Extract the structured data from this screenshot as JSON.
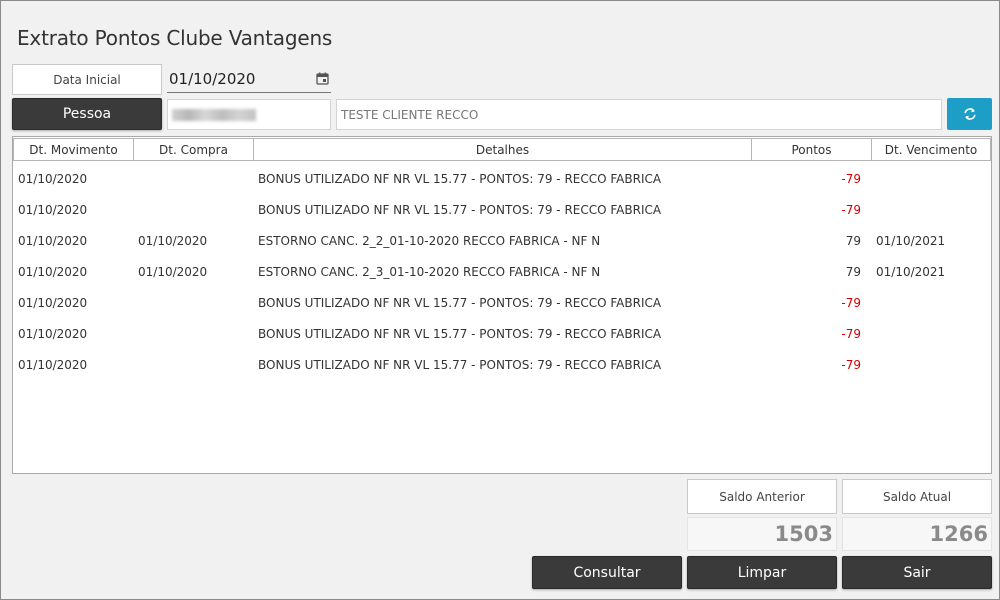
{
  "title": "Extrato Pontos Clube Vantagens",
  "filters": {
    "data_inicial_label": "Data Inicial",
    "data_inicial_value": "01/10/2020",
    "pessoa_button": "Pessoa",
    "pessoa_name": "TESTE CLIENTE RECCO"
  },
  "table": {
    "headers": [
      "Dt. Movimento",
      "Dt. Compra",
      "Detalhes",
      "Pontos",
      "Dt. Vencimento"
    ],
    "rows": [
      {
        "dt_movimento": "01/10/2020",
        "dt_compra": "",
        "detalhes": "BONUS UTILIZADO NF NR  VL 15.77 - PONTOS: 79 - RECCO FABRICA",
        "pontos": "-79",
        "dt_vencimento": ""
      },
      {
        "dt_movimento": "01/10/2020",
        "dt_compra": "",
        "detalhes": "BONUS UTILIZADO NF NR  VL 15.77 - PONTOS: 79 - RECCO FABRICA",
        "pontos": "-79",
        "dt_vencimento": ""
      },
      {
        "dt_movimento": "01/10/2020",
        "dt_compra": "01/10/2020",
        "detalhes": "ESTORNO CANC. 2_2_01-10-2020 RECCO FABRICA - NF N",
        "pontos": "79",
        "dt_vencimento": "01/10/2021"
      },
      {
        "dt_movimento": "01/10/2020",
        "dt_compra": "01/10/2020",
        "detalhes": "ESTORNO CANC. 2_3_01-10-2020 RECCO FABRICA - NF N",
        "pontos": "79",
        "dt_vencimento": "01/10/2021"
      },
      {
        "dt_movimento": "01/10/2020",
        "dt_compra": "",
        "detalhes": "BONUS UTILIZADO NF NR  VL 15.77 - PONTOS: 79 - RECCO FABRICA",
        "pontos": "-79",
        "dt_vencimento": ""
      },
      {
        "dt_movimento": "01/10/2020",
        "dt_compra": "",
        "detalhes": "BONUS UTILIZADO NF NR  VL 15.77 - PONTOS: 79 - RECCO FABRICA",
        "pontos": "-79",
        "dt_vencimento": ""
      },
      {
        "dt_movimento": "01/10/2020",
        "dt_compra": "",
        "detalhes": "BONUS UTILIZADO NF NR  VL 15.77 - PONTOS: 79 - RECCO FABRICA",
        "pontos": "-79",
        "dt_vencimento": ""
      }
    ]
  },
  "summary": {
    "saldo_anterior_label": "Saldo Anterior",
    "saldo_anterior_value": "1503",
    "saldo_atual_label": "Saldo Atual",
    "saldo_atual_value": "1266"
  },
  "buttons": {
    "consultar": "Consultar",
    "limpar": "Limpar",
    "sair": "Sair"
  },
  "colors": {
    "negative": "#d40000",
    "accent": "#1d9ec6",
    "dark_button": "#3a3a3a"
  },
  "icons": {
    "calendar": "calendar-icon",
    "refresh": "refresh-icon"
  }
}
